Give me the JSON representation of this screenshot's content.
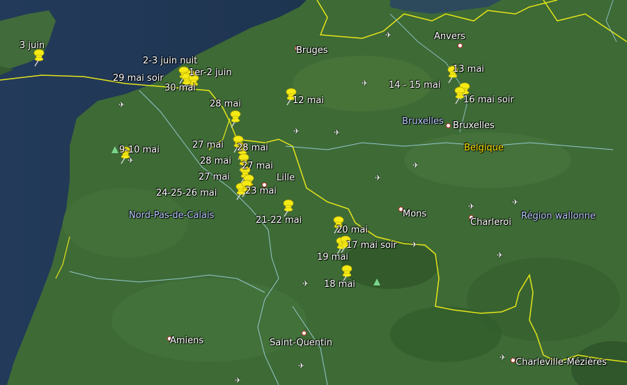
{
  "map": {
    "cities": {
      "anvers": "Anvers",
      "bruges": "Bruges",
      "bruxelles_nl": "Bruxelles",
      "bruxelles": "Bruxelles",
      "lille": "Lille",
      "mons": "Mons",
      "charleroi": "Charleroi",
      "amiens": "Amiens",
      "saint_quentin": "Saint-Quentin",
      "charleville": "Charleville-Mézières"
    },
    "regions": {
      "nord_pas_de_calais": "Nord-Pas-de-Calais",
      "region_wallonne": "Région wallonne"
    },
    "countries": {
      "belgique": "Belgique"
    },
    "pins": [
      {
        "id": "3-juin",
        "label": "3 juin"
      },
      {
        "id": "2-3-juin-nuit",
        "label": "2-3 juin nuit"
      },
      {
        "id": "1er-2-juin",
        "label": "1er-2 juin"
      },
      {
        "id": "29-mai-soir",
        "label": "29 mai soir"
      },
      {
        "id": "30-mai",
        "label": "30 mai"
      },
      {
        "id": "12-mai",
        "label": "12 mai"
      },
      {
        "id": "13-mai",
        "label": "13 mai"
      },
      {
        "id": "14-15-mai",
        "label": "14 - 15 mai"
      },
      {
        "id": "16-mai-soir",
        "label": "16 mai soir"
      },
      {
        "id": "28-mai-a",
        "label": "28 mai"
      },
      {
        "id": "27-mai-a",
        "label": "27 mai"
      },
      {
        "id": "28-mai-b",
        "label": "28 mai"
      },
      {
        "id": "9-10-mai",
        "label": "9-10 mai"
      },
      {
        "id": "28-mai-c",
        "label": "28 mai"
      },
      {
        "id": "27-mai-b",
        "label": "27 mai"
      },
      {
        "id": "27-mai-c",
        "label": "27 mai"
      },
      {
        "id": "24-25-26-mai",
        "label": "24-25-26 mai"
      },
      {
        "id": "23-mai",
        "label": "23 mai"
      },
      {
        "id": "21-22-mai",
        "label": "21-22 mai"
      },
      {
        "id": "20-mai",
        "label": "20 mai"
      },
      {
        "id": "17-mai-soir",
        "label": "17 mai soir"
      },
      {
        "id": "19-mai",
        "label": "19 mai"
      },
      {
        "id": "18-mai",
        "label": "18 mai"
      }
    ]
  },
  "colors": {
    "pin": "#f5ea16",
    "border": "#e6e619",
    "region_border": "#9fd3e0",
    "label": "#ffffff",
    "country_label": "#ffe600",
    "region_label": "#b8c8ff"
  }
}
